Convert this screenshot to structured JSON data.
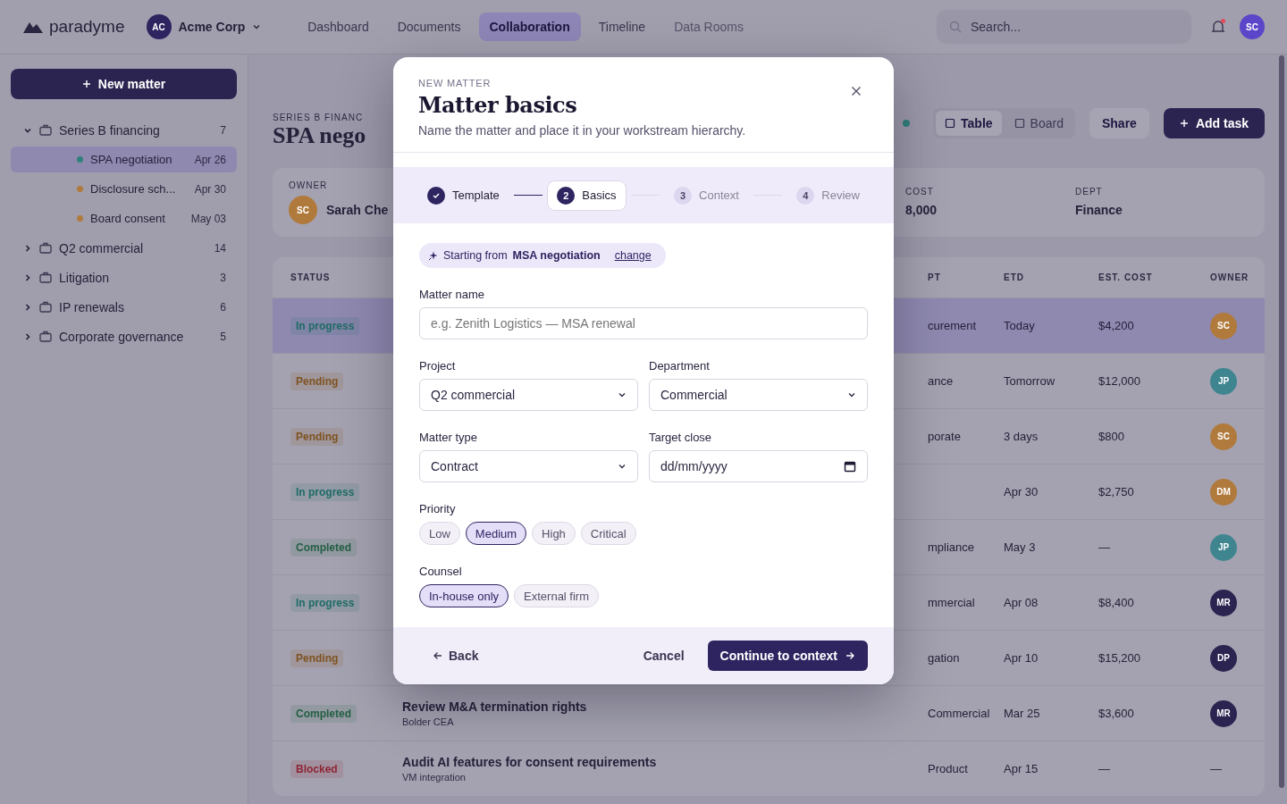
{
  "topbar": {
    "logo": "paradyme",
    "workspace": {
      "initials": "AC",
      "name": "Acme Corp"
    },
    "nav": [
      {
        "label": "Dashboard",
        "selected": false
      },
      {
        "label": "Documents",
        "selected": false
      },
      {
        "label": "Collaboration",
        "selected": true
      },
      {
        "label": "Timeline",
        "selected": false
      },
      {
        "label": "Data Rooms",
        "selected": false,
        "disabled": true
      }
    ],
    "search": {
      "placeholder": "Search..."
    },
    "user_initials": "SC"
  },
  "sidebar": {
    "new_button": "New matter",
    "tree": [
      {
        "label": "Series B financing",
        "count": "7",
        "expanded": true,
        "children": [
          {
            "label": "SPA negotiation",
            "date": "Apr 26",
            "color": "#2f7f7a",
            "selected": true
          },
          {
            "label": "Disclosure sch...",
            "date": "Apr 30",
            "color": "#b07a3c",
            "selected": false
          },
          {
            "label": "Board consent",
            "date": "May 03",
            "color": "#b07a3c",
            "selected": false
          }
        ]
      },
      {
        "label": "Q2 commercial",
        "count": "14",
        "expanded": false
      },
      {
        "label": "Litigation",
        "count": "3",
        "expanded": false
      },
      {
        "label": "IP renewals",
        "count": "6",
        "expanded": false
      },
      {
        "label": "Corporate governance",
        "count": "5",
        "expanded": false
      }
    ]
  },
  "page": {
    "breadcrumb": "SERIES B FINANC",
    "title": "SPA nego",
    "views": [
      {
        "label": "Table",
        "selected": true
      },
      {
        "label": "Board",
        "selected": false
      }
    ],
    "share": "Share",
    "add_task": "Add task",
    "owner": {
      "label": "OWNER",
      "initials": "SC",
      "name": "Sarah Che"
    },
    "info": [
      {
        "label": "COST",
        "value": "8,000"
      },
      {
        "label": "DEPT",
        "value": "Finance"
      }
    ]
  },
  "table": {
    "columns": [
      "STATUS",
      "PT",
      "ETD",
      "EST. COST",
      "OWNER"
    ],
    "rows": [
      {
        "status": "In progress",
        "color": "#1f6b66",
        "dept": "curement",
        "etd": "Today",
        "cost": "$4,200",
        "owner": {
          "initials": "SC",
          "color": "#b07a3c"
        },
        "selected": true
      },
      {
        "status": "Pending",
        "color": "#7f5220",
        "dept": "ance",
        "etd": "Tomorrow",
        "cost": "$12,000",
        "owner": {
          "initials": "JP",
          "color": "#3f8590"
        },
        "selected": false
      },
      {
        "status": "Pending",
        "color": "#7f5220",
        "dept": "porate",
        "etd": "3 days",
        "cost": "$800",
        "owner": {
          "initials": "SC",
          "color": "#b07a3c"
        },
        "selected": false
      },
      {
        "status": "In progress",
        "color": "#1f6b66",
        "etd": "Apr 30",
        "cost": "$2,750",
        "owner": {
          "initials": "DM",
          "color": "#b07a3c"
        },
        "selected": false
      },
      {
        "status": "Completed",
        "color": "#235f44",
        "dept": "mpliance",
        "etd": "May 3",
        "cost": "—",
        "owner": {
          "initials": "JP",
          "color": "#3f8590"
        },
        "selected": false
      },
      {
        "status": "In progress",
        "color": "#1f6b66",
        "dept": "mmercial",
        "etd": "Apr 08",
        "cost": "$8,400",
        "owner": {
          "initials": "MR",
          "color": "#2b2450"
        },
        "selected": false
      },
      {
        "status": "Pending",
        "color": "#7f5220",
        "dept": "gation",
        "etd": "Apr 10",
        "cost": "$15,200",
        "owner": {
          "initials": "DP",
          "color": "#2b2450"
        },
        "selected": false
      },
      {
        "status": "Completed",
        "color": "#235f44",
        "task": "Review M&A termination rights",
        "task_sub": "Bolder CEA",
        "dept": "Commercial",
        "etd": "Mar 25",
        "cost": "$3,600",
        "owner": {
          "initials": "MR",
          "color": "#2b2450"
        },
        "selected": false
      },
      {
        "status": "Blocked",
        "color": "#8e2535",
        "task": "Audit AI features for consent requirements",
        "task_sub": "VM integration",
        "dept": "Product",
        "etd": "Apr 15",
        "cost": "—",
        "owner": {
          "initials": "—"
        },
        "selected": false
      }
    ]
  },
  "modal": {
    "eyebrow": "NEW MATTER",
    "title": "Matter basics",
    "subtitle": "Name the matter and place it in your workstream hierarchy.",
    "steps": [
      {
        "label": "Template",
        "kind": "done"
      },
      {
        "number": "2",
        "label": "Basics",
        "kind": "current"
      },
      {
        "number": "3",
        "label": "Context",
        "kind": "pending"
      },
      {
        "number": "4",
        "label": "Review",
        "kind": "pending"
      }
    ],
    "template_chip": {
      "prefix": "Starting from",
      "name": "MSA negotiation",
      "link": "change"
    },
    "fields": [
      {
        "kind": "text",
        "label": "Matter name",
        "placeholder": "e.g. Zenith Logistics — MSA renewal"
      },
      {
        "kind": "select",
        "label": "Project",
        "value": "Q2 commercial"
      },
      {
        "kind": "select",
        "label": "Department",
        "value": "Commercial"
      },
      {
        "kind": "select",
        "label": "Matter type",
        "value": "Contract"
      },
      {
        "kind": "date",
        "label": "Target close",
        "placeholder": "dd/mm/yyyy"
      }
    ],
    "priority": {
      "label": "Priority",
      "options": [
        {
          "label": "Low",
          "selected": false
        },
        {
          "label": "Medium",
          "selected": true
        },
        {
          "label": "High",
          "selected": false
        },
        {
          "label": "Critical",
          "selected": false
        }
      ]
    },
    "counsel": {
      "label": "Counsel",
      "options": [
        {
          "label": "In-house only",
          "selected": true
        },
        {
          "label": "External firm",
          "selected": false
        }
      ]
    },
    "back": "Back",
    "cancel": "Cancel",
    "continue": "Continue to context"
  }
}
